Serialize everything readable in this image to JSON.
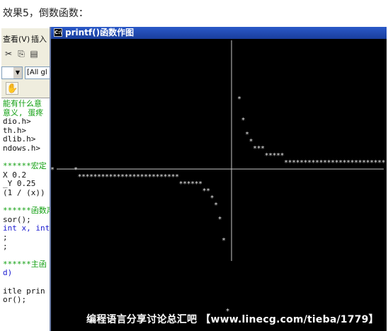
{
  "caption": "效果5，倒数函数：",
  "ide": {
    "menu": [
      "查看(V)",
      "插入"
    ],
    "toolbar_combo_left": "",
    "toolbar_combo_right": "[All gl",
    "code_lines": [
      {
        "text": "能有什么意",
        "color": "green"
      },
      {
        "text": "意义, 蛋疼",
        "color": "green"
      },
      {
        "text": "dio.h>",
        "color": "black"
      },
      {
        "text": "th.h>",
        "color": "black"
      },
      {
        "text": "dlib.h>",
        "color": "black"
      },
      {
        "text": "ndows.h>",
        "color": "black"
      },
      {
        "text": "",
        "color": "black"
      },
      {
        "text": "******宏定",
        "color": "green"
      },
      {
        "text": " X 0.2",
        "color": "black"
      },
      {
        "text": "_Y 0.25",
        "color": "black"
      },
      {
        "text": " (1 / (x))",
        "color": "black"
      },
      {
        "text": "",
        "color": "black"
      },
      {
        "text": "******函数声",
        "color": "green"
      },
      {
        "text": "sor();",
        "color": "black"
      },
      {
        "text": "int x, int",
        "color": "blue"
      },
      {
        "text": ";",
        "color": "black"
      },
      {
        "text": ";",
        "color": "black"
      },
      {
        "text": "",
        "color": "black"
      },
      {
        "text": "******主函",
        "color": "green"
      },
      {
        "text": "d)",
        "color": "blue"
      },
      {
        "text": "",
        "color": "black"
      },
      {
        "text": "itle prin",
        "color": "black"
      },
      {
        "text": "or();",
        "color": "black"
      }
    ]
  },
  "console": {
    "title": "printf()函数作图",
    "icon": "console-icon",
    "plot_glyph": "*",
    "plot": {
      "function": "1 / (x)",
      "x_step": 0.2,
      "y_step": 0.25
    }
  },
  "watermark": "编程语言分享讨论总汇吧 【www.linecg.com/tieba/1779】",
  "colors": {
    "console_bg": "#000000",
    "console_fg": "#c0c0c0",
    "title_bar": "#2a59c8",
    "comment_green": "#12a012",
    "keyword_blue": "#1a1ad0"
  }
}
